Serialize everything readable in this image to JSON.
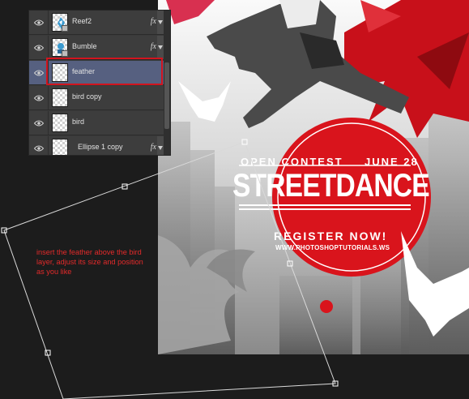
{
  "layers_panel": {
    "layers": [
      {
        "name": "Reef2",
        "visible": true,
        "has_fx": true,
        "thumb": "reef",
        "selected": false
      },
      {
        "name": "Bumble",
        "visible": true,
        "has_fx": true,
        "thumb": "bumble",
        "selected": false
      },
      {
        "name": "feather",
        "visible": true,
        "has_fx": false,
        "thumb": "empty",
        "selected": true
      },
      {
        "name": "bird copy",
        "visible": true,
        "has_fx": false,
        "thumb": "empty",
        "selected": false
      },
      {
        "name": "bird",
        "visible": true,
        "has_fx": false,
        "thumb": "empty",
        "selected": false
      },
      {
        "name": "Ellipse 1 copy",
        "visible": true,
        "has_fx": true,
        "thumb": "empty",
        "selected": false
      }
    ],
    "fx_label": "fx",
    "eye_icon": "eye-icon",
    "highlight_color": "#d2141e"
  },
  "poster": {
    "open_contest": "OPEN CONTEST",
    "date": "JUNE 28",
    "title": "STREETDANCE",
    "register": "REGISTER NOW!",
    "website": "WWW.PHOTOSHOPTUTORIALS.WS",
    "accent_color": "#d9141c"
  },
  "instruction": {
    "text": "insert the feather above the bird layer, adjust its size and position as you like",
    "color": "#e32a2a"
  },
  "colors": {
    "background": "#1c1c1c",
    "panel": "#3a3a3a",
    "selected_row": "#566080"
  }
}
